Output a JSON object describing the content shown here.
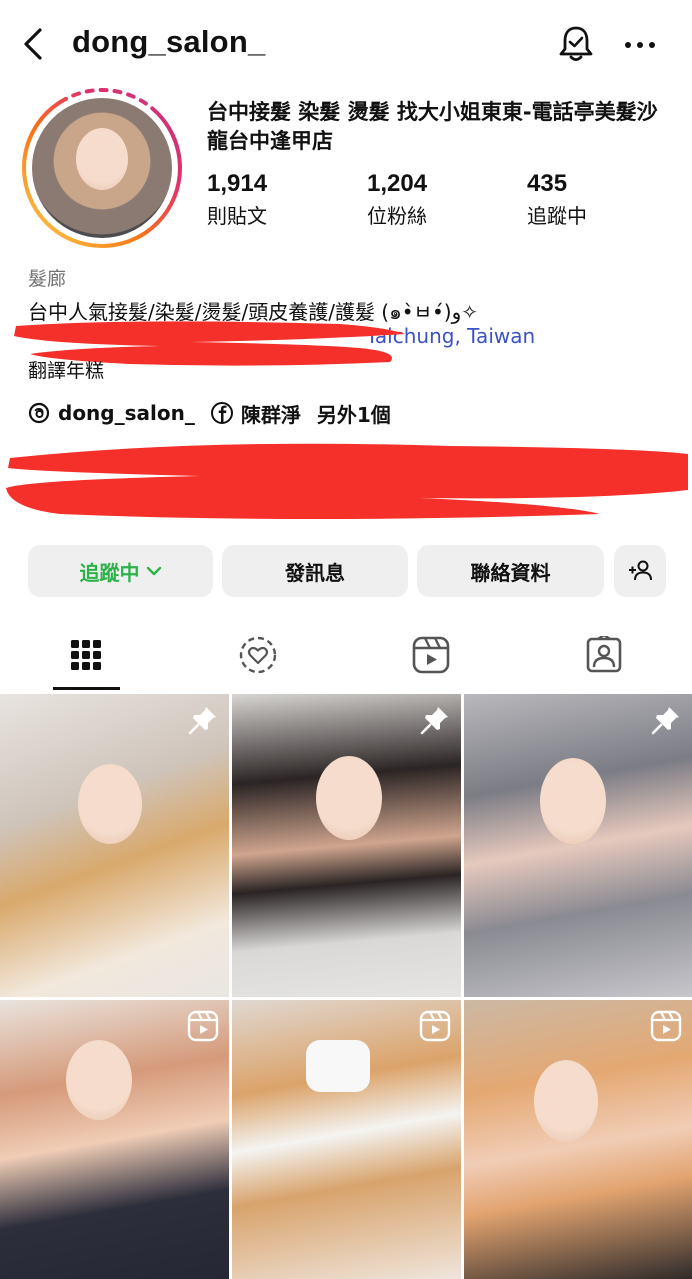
{
  "header": {
    "username": "dong_salon_",
    "icons": {
      "back": "chevron-left-icon",
      "notifications": "bell-check-icon",
      "more": "more-horizontal-icon"
    }
  },
  "profile": {
    "display_name": "台中接髮 染髮 燙髮 找大小姐東東-電話亭美髮沙龍台中逢甲店",
    "stats": {
      "posts": {
        "value": "1,914",
        "label": "則貼文"
      },
      "followers": {
        "value": "1,204",
        "label": "位粉絲"
      },
      "following": {
        "value": "435",
        "label": "追蹤中"
      }
    },
    "category": "髮廊",
    "bio_line1": "台中人氣接髮/染髮/燙髮/頭皮養護/護髮 (๑•̀ㅂ•́)و✧",
    "bio_location_fragment": "Taichung, Taiwan",
    "translate": "翻譯年糕",
    "links": {
      "threads": "dong_salon_",
      "facebook": "陳群淨",
      "others": "另外1個"
    }
  },
  "actions": {
    "following": "追蹤中",
    "message": "發訊息",
    "contact": "聯絡資料"
  },
  "tabs": [
    "grid-icon",
    "collab-icon",
    "reels-icon",
    "tagged-icon"
  ],
  "colors": {
    "following_green": "#2bb34a",
    "link_blue": "#3b52c7",
    "redaction_red": "#f5302a",
    "button_gray": "#efefef"
  },
  "posts": [
    {
      "badge": "pin-icon"
    },
    {
      "badge": "pin-icon"
    },
    {
      "badge": "pin-icon"
    },
    {
      "badge": "reels-icon"
    },
    {
      "badge": "reels-icon"
    },
    {
      "badge": "reels-icon"
    }
  ]
}
